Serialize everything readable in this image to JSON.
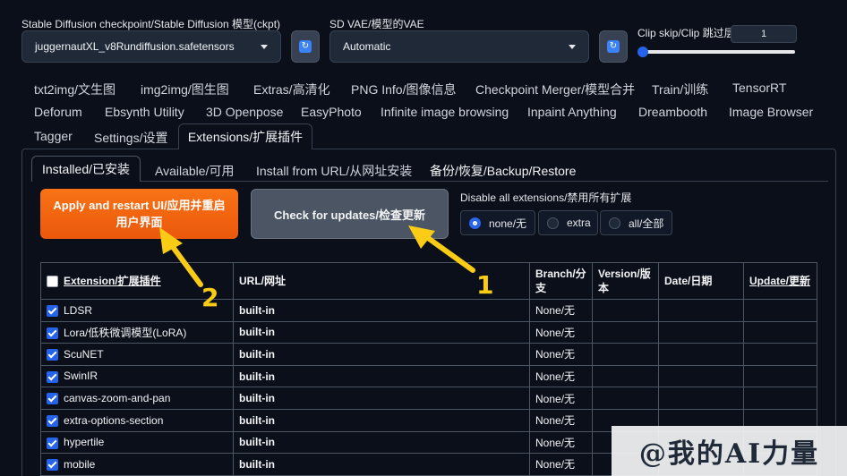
{
  "settings": {
    "checkpoint_label": "Stable Diffusion checkpoint/Stable Diffusion 模型(ckpt)",
    "checkpoint_value": "juggernautXL_v8Rundiffusion.safetensors",
    "vae_label": "SD VAE/模型的VAE",
    "vae_value": "Automatic",
    "clip_label": "Clip skip/Clip 跳过层",
    "clip_value": "1",
    "clip_level": 0.0
  },
  "tabs": [
    {
      "label": "txt2img/文生图"
    },
    {
      "label": "img2img/图生图"
    },
    {
      "label": "Extras/高清化"
    },
    {
      "label": "PNG Info/图像信息"
    },
    {
      "label": "Checkpoint Merger/模型合并"
    },
    {
      "label": "Train/训练"
    },
    {
      "label": "TensorRT"
    },
    {
      "label": "Deforum"
    },
    {
      "label": "Ebsynth Utility"
    },
    {
      "label": "3D Openpose"
    },
    {
      "label": "EasyPhoto"
    },
    {
      "label": "Infinite image browsing"
    },
    {
      "label": "Inpaint Anything"
    },
    {
      "label": "Dreambooth"
    },
    {
      "label": "Image Browser"
    },
    {
      "label": "Tagger"
    },
    {
      "label": "Settings/设置"
    },
    {
      "label": "Extensions/扩展插件"
    }
  ],
  "subtabs": [
    {
      "label": "Installed/已安装"
    },
    {
      "label": "Available/可用"
    },
    {
      "label": "Install from URL/从网址安装"
    },
    {
      "label": "备份/恢复/Backup/Restore"
    }
  ],
  "buttons": {
    "apply_restart": "Apply and restart UI/应用并重启用户界面",
    "check_updates": "Check for updates/检查更新"
  },
  "disable": {
    "label": "Disable all extensions/禁用所有扩展",
    "options": [
      "none/无",
      "extra",
      "all/全部"
    ],
    "selected": "none/无"
  },
  "table": {
    "headers": [
      "Extension/扩展插件",
      "URL/网址",
      "Branch/分支",
      "Version/版本",
      "Date/日期",
      "Update/更新"
    ],
    "rows": [
      {
        "name": "LDSR",
        "url": "built-in",
        "branch": "None/无"
      },
      {
        "name": "Lora/低秩微调模型(LoRA)",
        "url": "built-in",
        "branch": "None/无"
      },
      {
        "name": "ScuNET",
        "url": "built-in",
        "branch": "None/无"
      },
      {
        "name": "SwinIR",
        "url": "built-in",
        "branch": "None/无"
      },
      {
        "name": "canvas-zoom-and-pan",
        "url": "built-in",
        "branch": "None/无"
      },
      {
        "name": "extra-options-section",
        "url": "built-in",
        "branch": "None/无"
      },
      {
        "name": "hypertile",
        "url": "built-in",
        "branch": "None/无"
      },
      {
        "name": "mobile",
        "url": "built-in",
        "branch": "None/无"
      }
    ]
  },
  "annotations": {
    "one": "1",
    "two": "2",
    "color": "#facc15"
  },
  "watermark": "@我的AI力量",
  "colors": {
    "accent": "#2563eb",
    "orange": "#ea580c",
    "background": "#0b0f19"
  }
}
